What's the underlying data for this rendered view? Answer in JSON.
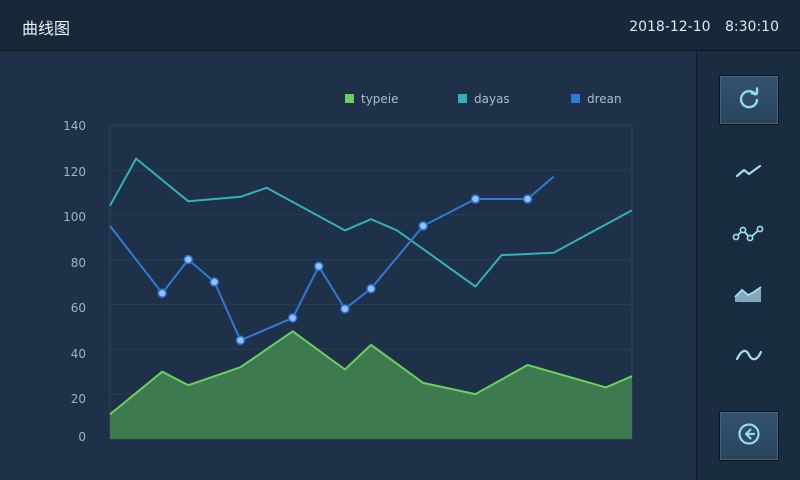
{
  "header": {
    "title": "曲线图",
    "date": "2018-12-10",
    "time": "8:30:10"
  },
  "sidebar": {
    "buttons": [
      "refresh-icon",
      "line-chart-icon",
      "dotted-line-chart-icon",
      "area-chart-icon",
      "wave-icon",
      "back-icon"
    ]
  },
  "colors": {
    "typeie": "#6cd05c",
    "dayas": "#2fb3b8",
    "drean": "#2f7ad6"
  },
  "chart_data": {
    "type": "line",
    "title": "",
    "xlabel": "",
    "ylabel": "",
    "ylim": [
      0,
      140
    ],
    "yticks": [
      0,
      20,
      40,
      60,
      80,
      100,
      120,
      140
    ],
    "grid": true,
    "legend_position": "top-right",
    "legend": [
      "typeie",
      "dayas",
      "drean"
    ],
    "series": [
      {
        "name": "typeie",
        "style": "area",
        "points": [
          [
            0,
            11
          ],
          [
            2,
            30
          ],
          [
            3,
            24
          ],
          [
            5,
            32
          ],
          [
            7,
            48
          ],
          [
            9,
            31
          ],
          [
            10,
            42
          ],
          [
            12,
            25
          ],
          [
            14,
            20
          ],
          [
            16,
            33
          ],
          [
            19,
            23
          ],
          [
            20,
            28
          ]
        ]
      },
      {
        "name": "dayas",
        "style": "line",
        "points": [
          [
            0,
            104
          ],
          [
            1,
            125
          ],
          [
            3,
            106
          ],
          [
            5,
            108
          ],
          [
            6,
            112
          ],
          [
            9,
            93
          ],
          [
            10,
            98
          ],
          [
            11,
            93
          ],
          [
            14,
            68
          ],
          [
            15,
            82
          ],
          [
            17,
            83
          ],
          [
            20,
            102
          ]
        ]
      },
      {
        "name": "drean",
        "style": "line-markers",
        "points": [
          [
            0,
            95
          ],
          [
            2,
            65
          ],
          [
            3,
            80
          ],
          [
            4,
            70
          ],
          [
            5,
            44
          ],
          [
            7,
            54
          ],
          [
            8,
            77
          ],
          [
            9,
            58
          ],
          [
            10,
            67
          ],
          [
            12,
            95
          ],
          [
            14,
            107
          ],
          [
            16,
            107
          ],
          [
            17,
            117
          ]
        ]
      }
    ]
  }
}
